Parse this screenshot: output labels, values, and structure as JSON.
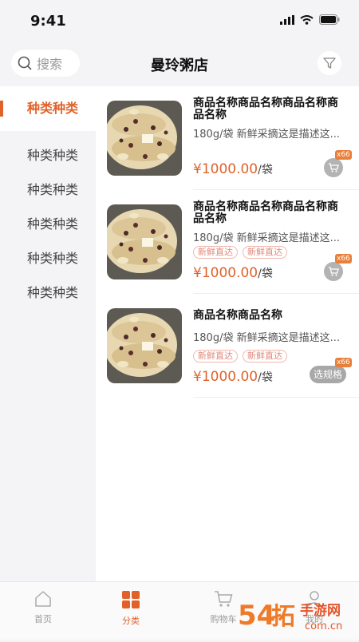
{
  "status": {
    "time": "9:41"
  },
  "header": {
    "search_placeholder": "搜索",
    "title": "曼玲粥店"
  },
  "sidebar": {
    "items": [
      {
        "label": "种类种类",
        "active": true
      },
      {
        "label": "种类种类"
      },
      {
        "label": "种类种类"
      },
      {
        "label": "种类种类"
      },
      {
        "label": "种类种类"
      },
      {
        "label": "种类种类"
      }
    ]
  },
  "products": [
    {
      "name": "商品名称商品名称商品名称商品名称",
      "desc": "180g/袋 新鲜采摘这是描述这...",
      "tags": [],
      "price": "¥1000.00",
      "unit": "/袋",
      "action": "cart",
      "badge": "x66"
    },
    {
      "name": "商品名称商品名称商品名称商品名称",
      "desc": "180g/袋 新鲜采摘这是描述这...",
      "tags": [
        "新鲜直达",
        "新鲜直达"
      ],
      "price": "¥1000.00",
      "unit": "/袋",
      "action": "cart",
      "badge": "x66"
    },
    {
      "name": "商品名称商品名称",
      "desc": "180g/袋 新鲜采摘这是描述这...",
      "tags": [
        "新鲜直达",
        "新鲜直达"
      ],
      "price": "¥1000.00",
      "unit": "/袋",
      "action": "spec",
      "action_label": "选规格",
      "badge": "x66"
    }
  ],
  "tabbar": {
    "items": [
      {
        "label": "首页",
        "icon": "home-icon"
      },
      {
        "label": "分类",
        "icon": "category-icon",
        "active": true
      },
      {
        "label": "购物车",
        "icon": "cart-icon"
      },
      {
        "label": "我的",
        "icon": "user-icon"
      }
    ]
  },
  "watermark": {
    "text": "54拓手游网",
    "sub": "com.cn"
  },
  "colors": {
    "accent": "#e0622a",
    "badge": "#e87f3a",
    "tag": "#e0897a"
  }
}
